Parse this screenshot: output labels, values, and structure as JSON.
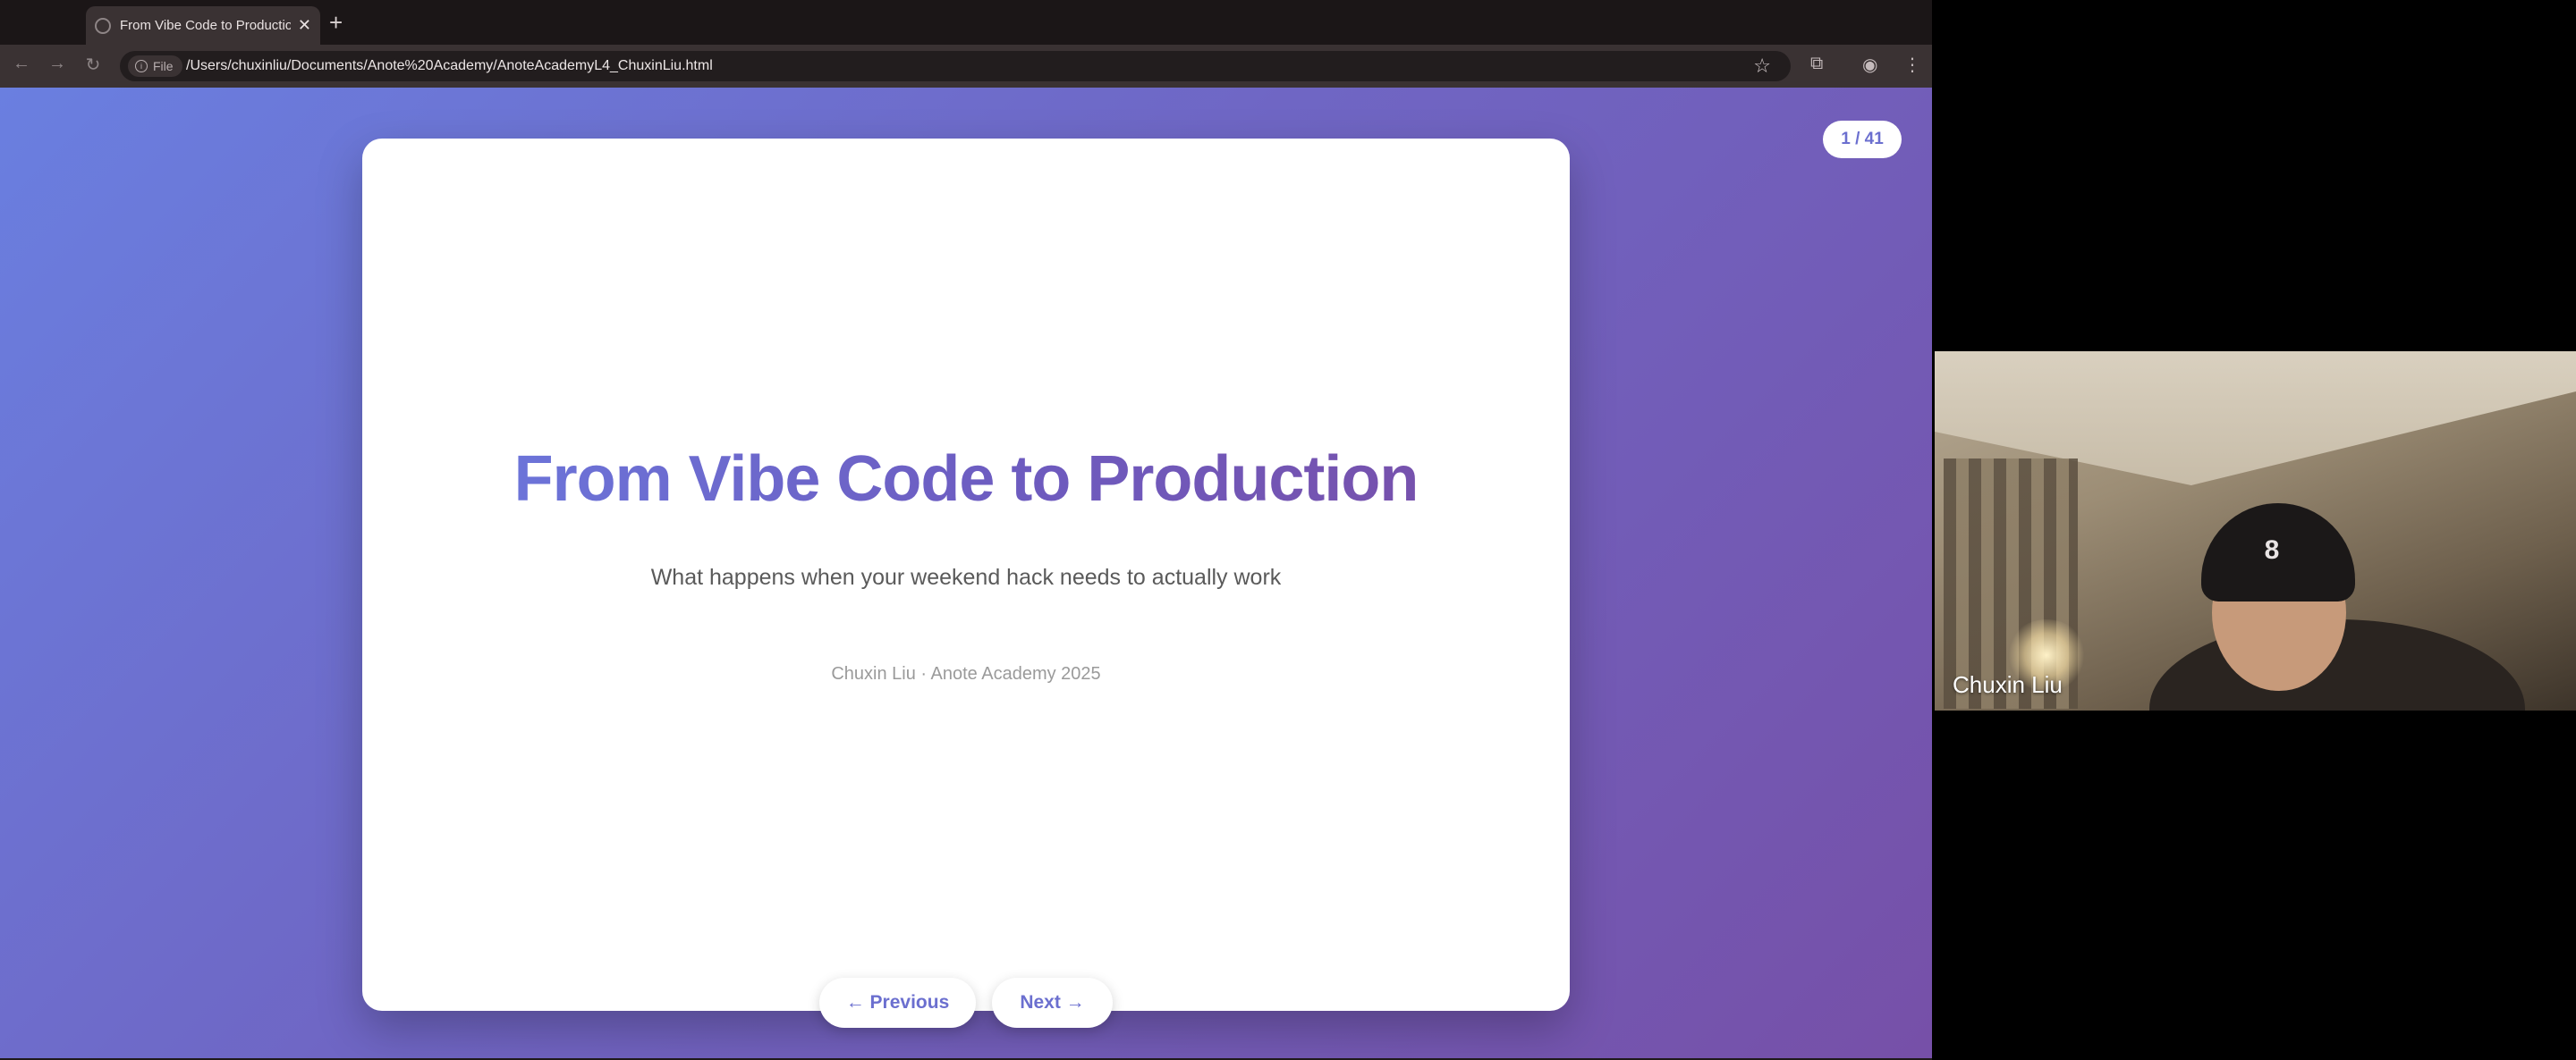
{
  "browser": {
    "tab": {
      "title": "From Vibe Code to Productio",
      "close_glyph": "✕"
    },
    "new_tab_glyph": "+",
    "address": {
      "chip_label": "File",
      "url": "/Users/chuxinliu/Documents/Anote%20Academy/AnoteAcademyL4_ChuxinLiu.html"
    }
  },
  "slide": {
    "counter": "1 / 41",
    "title": "From Vibe Code to Production",
    "subtitle": "What happens when your weekend hack needs to actually work",
    "author": "Chuxin Liu · Anote Academy 2025",
    "prev_label": "← Previous",
    "next_label": "Next →"
  },
  "video": {
    "participant_name": "Chuxin Liu",
    "beanie_glyph": "8"
  },
  "colors": {
    "accent": "#6b6fcf",
    "gradient_start": "#6a7fe0",
    "gradient_end": "#7650a8"
  }
}
